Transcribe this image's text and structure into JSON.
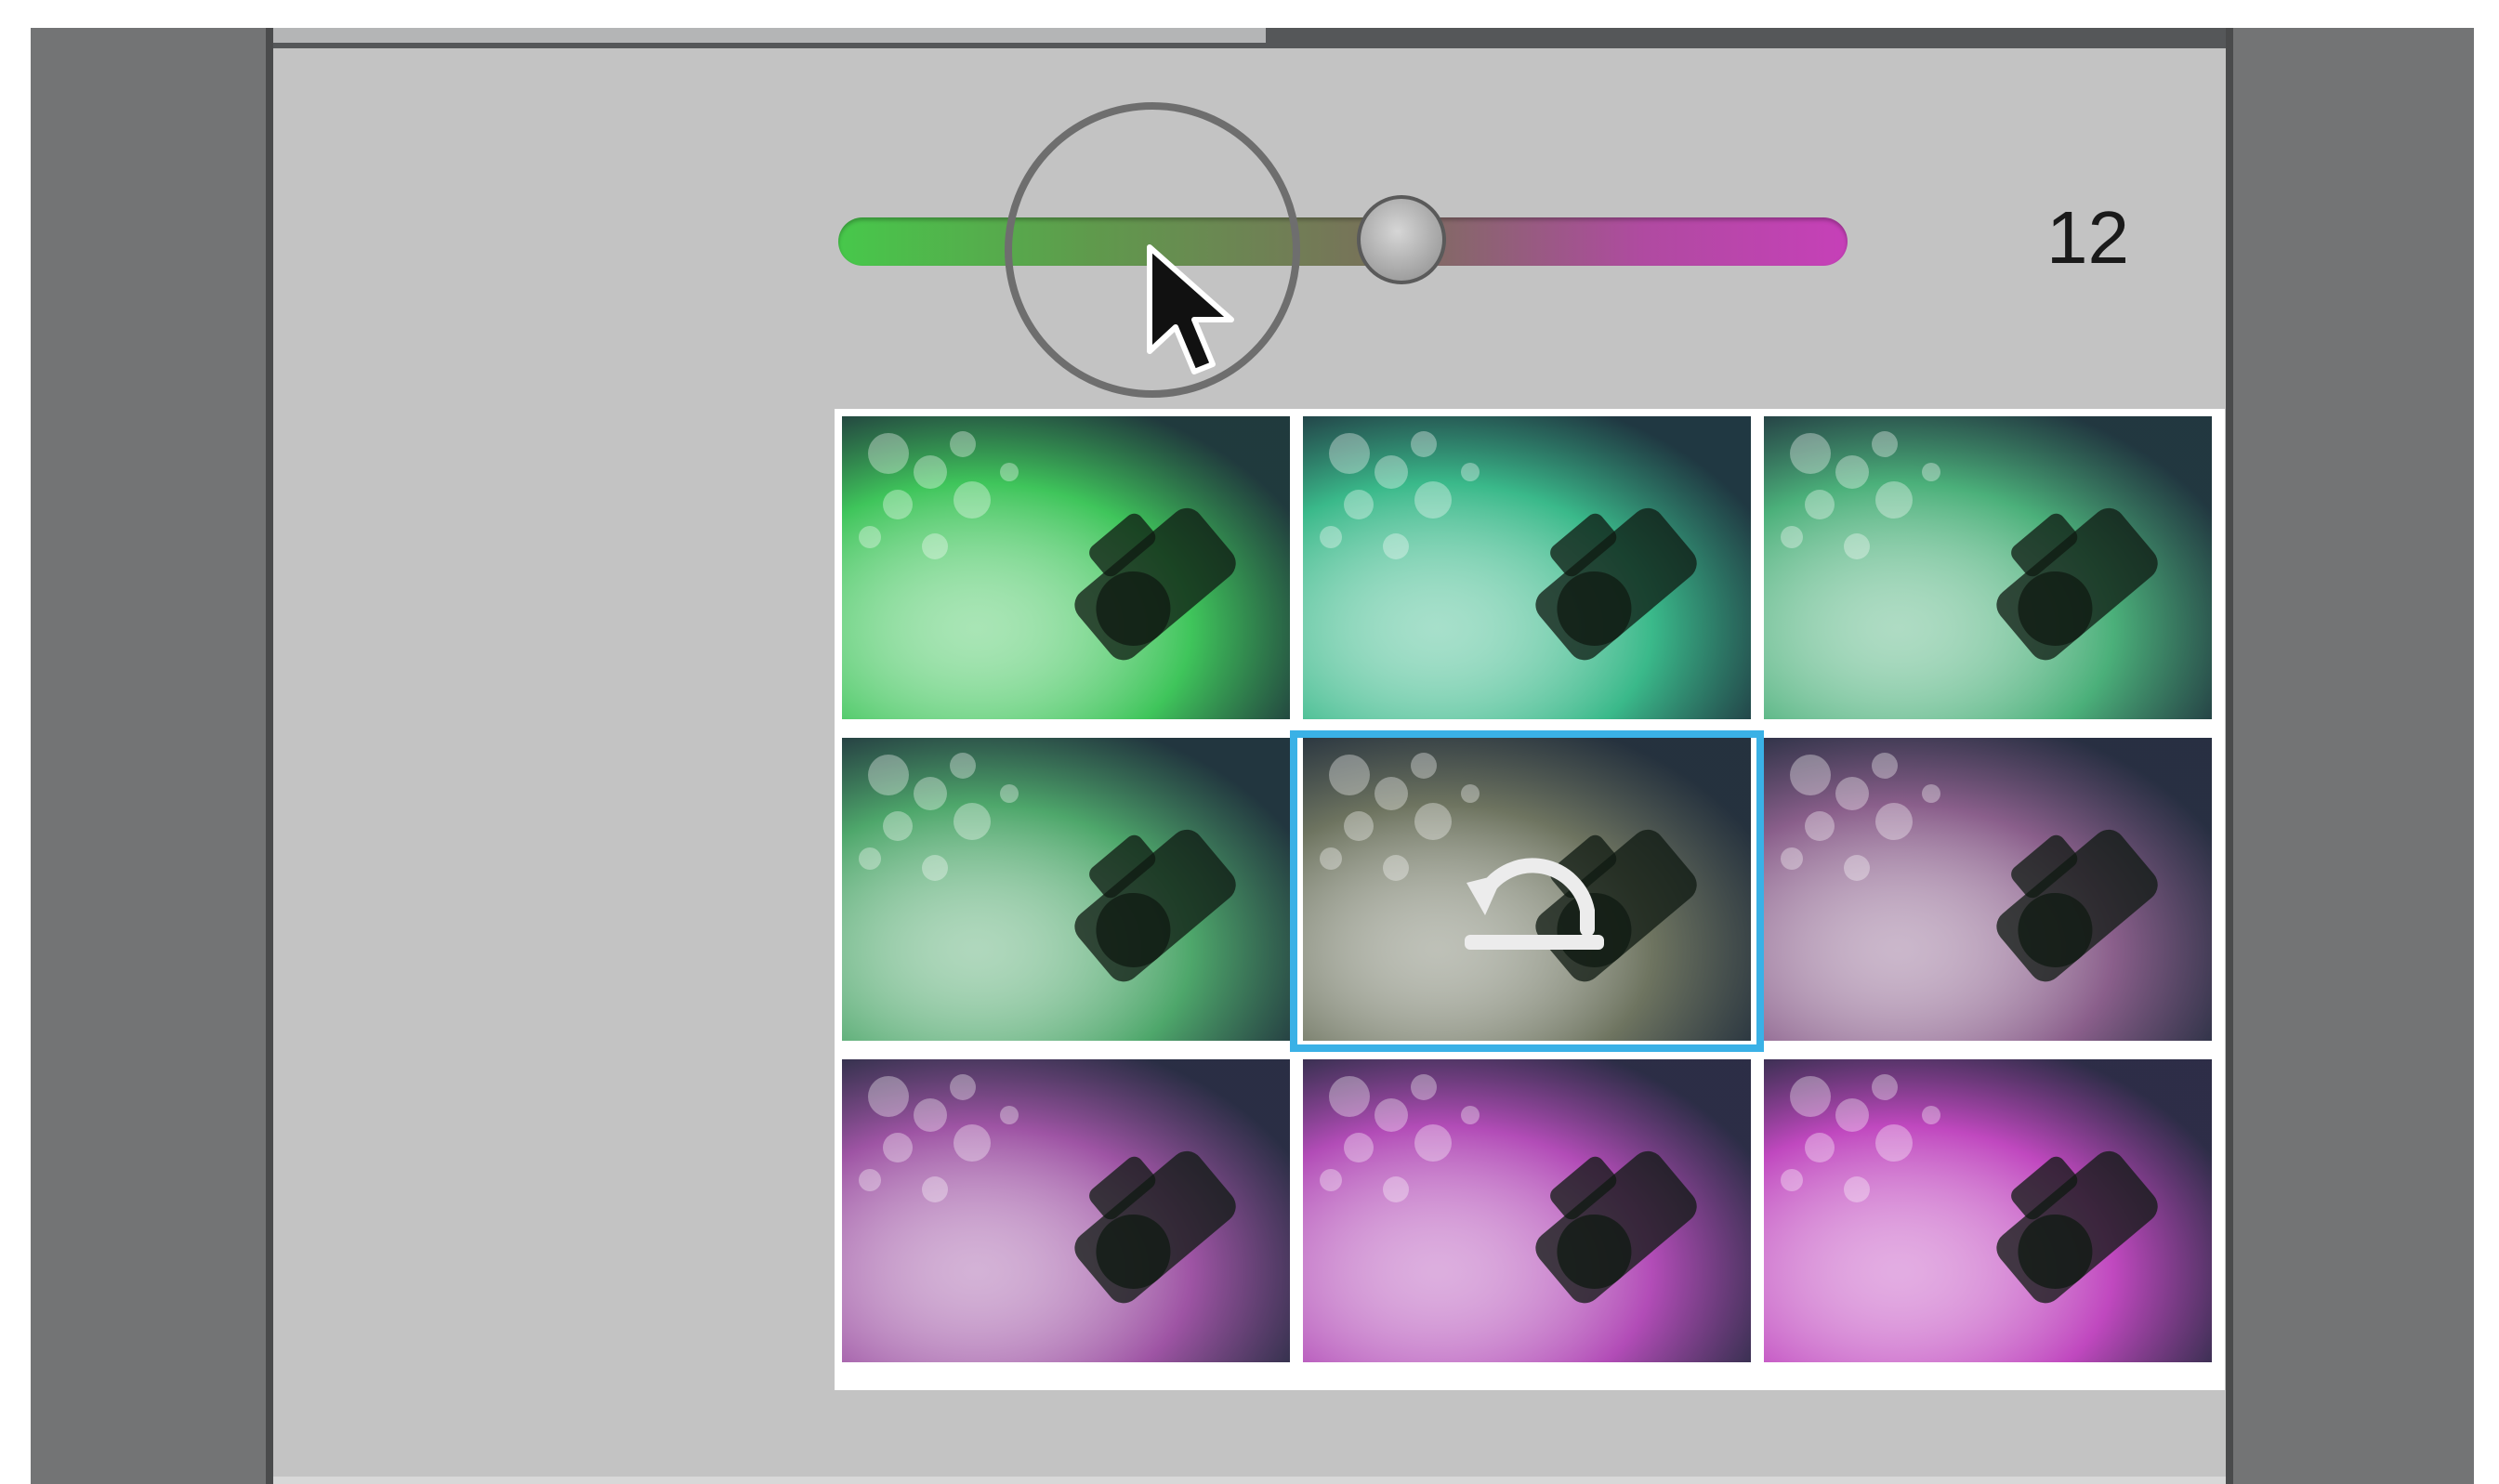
{
  "slider": {
    "value_label": "12",
    "value": 12,
    "track_colors": [
      "#47c84b",
      "#c640b8"
    ]
  },
  "variations": [
    {
      "color": "#3fc55b"
    },
    {
      "color": "#3ab98a"
    },
    {
      "color": "#4bb07a"
    },
    {
      "color": "#4ea76b"
    },
    {
      "color": "#6e7460"
    },
    {
      "color": "#8a5f8b"
    },
    {
      "color": "#9e54a4"
    },
    {
      "color": "#b24cb7"
    },
    {
      "color": "#c048bf"
    }
  ],
  "selected_index": 4,
  "accent_color": "#3ab1e6"
}
